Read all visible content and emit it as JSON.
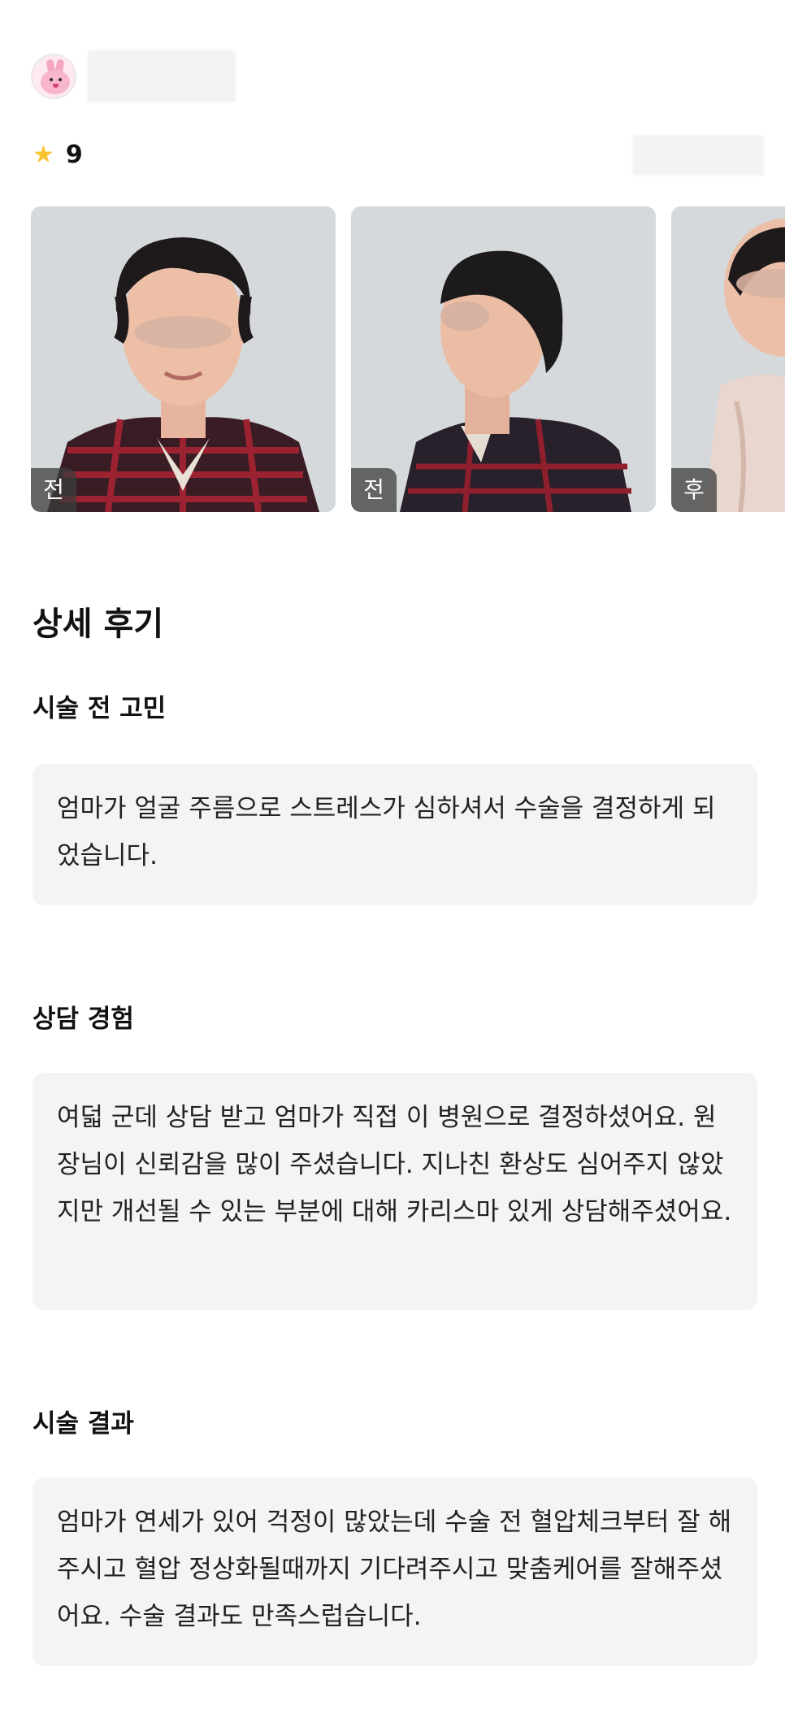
{
  "review": {
    "rating_icon": "star-icon",
    "rating": "9",
    "photos": [
      {
        "tag": "전"
      },
      {
        "tag": "전"
      },
      {
        "tag": "후"
      }
    ],
    "section_title": "상세 후기",
    "blocks": [
      {
        "heading": "시술 전 고민",
        "text": "엄마가 얼굴 주름으로 스트레스가 심하셔서 수술을 결정하게 되었습니다."
      },
      {
        "heading": "상담 경험",
        "text": "여덟 군데 상담 받고 엄마가 직접 이 병원으로 결정하셨어요. 원장님이 신뢰감을 많이 주셨습니다. 지나친 환상도 심어주지 않았지만 개선될 수 있는 부분에 대해 카리스마 있게 상담해주셨어요."
      },
      {
        "heading": "시술 결과",
        "text": "엄마가 연세가 있어 걱정이 많았는데 수술 전 혈압체크부터 잘 해주시고 혈압 정상화될때까지 기다려주시고 맞춤케어를 잘해주셨어요. 수술 결과도 만족스럽습니다."
      }
    ]
  },
  "colors": {
    "star": "#f8c530",
    "box_background": "#f4f4f4"
  }
}
